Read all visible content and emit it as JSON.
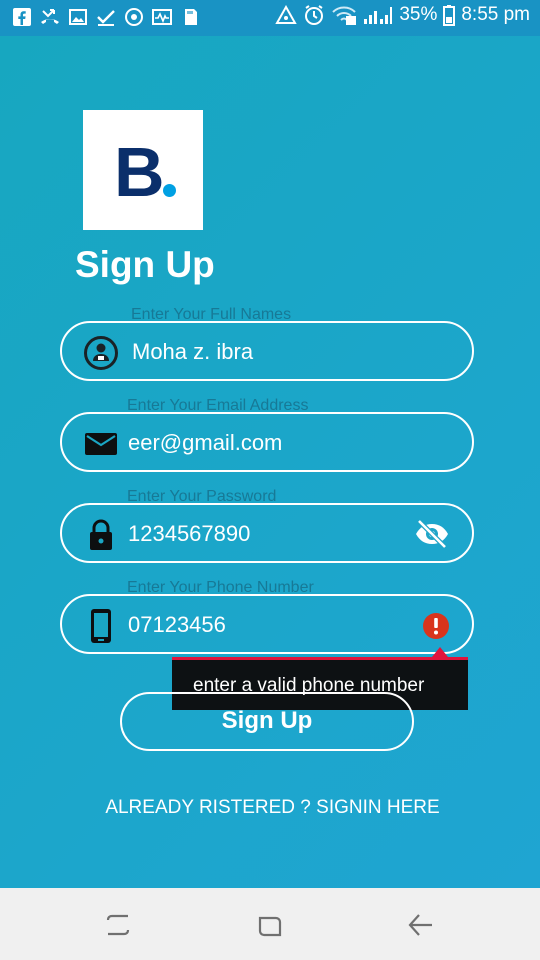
{
  "status_bar": {
    "left_icons": [
      "facebook-icon",
      "missed-call-icon",
      "image-icon",
      "check-icon",
      "sync-icon",
      "activity-icon",
      "sd-card-icon"
    ],
    "battery_percent": "35%",
    "time": "8:55 pm"
  },
  "logo": {
    "letter": "B"
  },
  "page_title": "Sign Up",
  "fields": {
    "name": {
      "label": "Enter Your Full Names",
      "value": "Moha z. ibra",
      "icon": "person-icon"
    },
    "email": {
      "label": "Enter Your Email Address",
      "value": "eer@gmail.com",
      "icon": "mail-icon"
    },
    "password": {
      "label": "Enter Your Password",
      "value": "1234567890",
      "icon": "lock-icon",
      "toggle_icon": "eye-off-icon"
    },
    "phone": {
      "label": "Enter Your Phone Number",
      "value": "07123456",
      "icon": "phone-icon",
      "error_icon": "error-icon"
    }
  },
  "error_tooltip": {
    "text": "enter a valid phone number"
  },
  "signup_button": {
    "label": "Sign Up"
  },
  "signin_link": {
    "label": "ALREADY RISTERED ? SIGNIN HERE"
  },
  "nav_bar": {
    "buttons": [
      "recent-apps-icon",
      "home-icon",
      "back-icon"
    ]
  },
  "colors": {
    "status_bar": "#1993c4",
    "background": "#1aa6c4",
    "logo_navy": "#0b2f6b",
    "logo_dot": "#00a0e3",
    "error_red": "#e0143c",
    "error_icon": "#d9341c"
  }
}
